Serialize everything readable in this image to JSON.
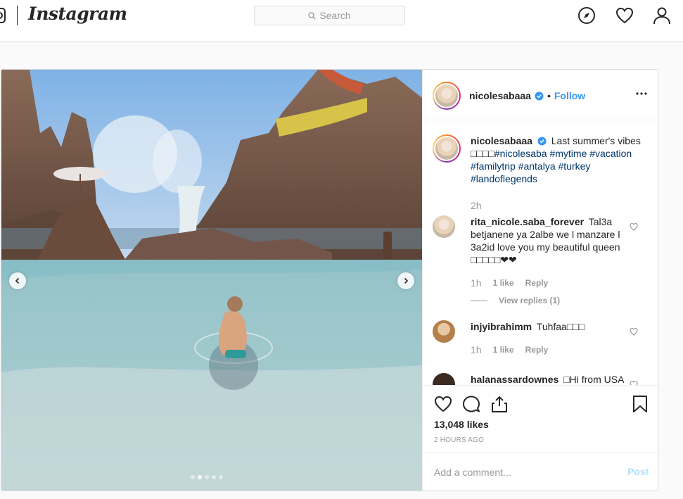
{
  "nav": {
    "logo": "Instagram",
    "search_placeholder": "Search"
  },
  "post": {
    "author": "nicolesabaaa",
    "follow_label": "Follow",
    "bullet": "•",
    "caption": {
      "username": "nicolesabaaa",
      "text": "Last summer's vibes",
      "emojis": "□□□□",
      "hashtags": [
        "#nicolesaba",
        "#mytime",
        "#vacation",
        "#familytrip",
        "#antalya",
        "#turkey",
        "#landoflegends"
      ],
      "time": "2h"
    },
    "comments": [
      {
        "username": "rita_nicole.saba_forever",
        "text": "Tal3a betjanene ya 2albe we l manzare l 3a2id love you my beautiful queen □□□□□❤❤",
        "time": "1h",
        "likes": "1 like",
        "reply": "Reply",
        "view_replies": "View replies (1)"
      },
      {
        "username": "injyibrahimm",
        "text": "Tuhfaa□□□",
        "time": "1h",
        "likes": "1 like",
        "reply": "Reply"
      },
      {
        "username": "halanassardownes",
        "text": "□Hi from USA"
      }
    ],
    "likes": "13,048 likes",
    "time_ago": "2 HOURS AGO",
    "comment_placeholder": "Add a comment...",
    "post_label": "Post",
    "carousel": {
      "slide_count": 5,
      "active_index": 1
    }
  },
  "colors": {
    "link": "#3897f0",
    "hashtag": "#003569",
    "muted": "#999999",
    "border": "#dbdbdb",
    "post_disabled": "#b2dffc"
  }
}
